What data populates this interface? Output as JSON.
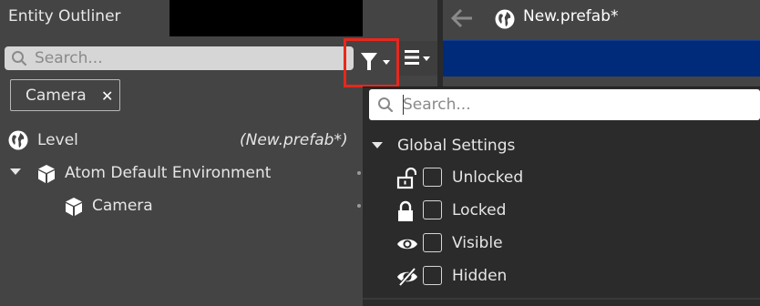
{
  "outliner": {
    "title": "Entity Outliner",
    "search_placeholder": "Search...",
    "filter_tag": "Camera",
    "filter_tag_close": "✕",
    "tree": {
      "level": {
        "label": "Level",
        "meta": "(New.prefab*)"
      },
      "atom": {
        "label": "Atom Default Environment"
      },
      "camera": {
        "label": "Camera"
      }
    }
  },
  "viewport": {
    "tab_title": "New.prefab*"
  },
  "filter_dropdown": {
    "search_placeholder": "Search...",
    "group_label": "Global Settings",
    "options": [
      {
        "label": "Unlocked",
        "icon": "unlock-icon",
        "checked": false
      },
      {
        "label": "Locked",
        "icon": "lock-icon",
        "checked": false
      },
      {
        "label": "Visible",
        "icon": "eye-icon",
        "checked": false
      },
      {
        "label": "Hidden",
        "icon": "eye-slash-icon",
        "checked": false
      }
    ]
  },
  "colors": {
    "highlight_border": "#e8271c",
    "viewport_blue": "#002a7a",
    "panel_bg": "#444444",
    "dropdown_bg": "#2b2b2b"
  }
}
